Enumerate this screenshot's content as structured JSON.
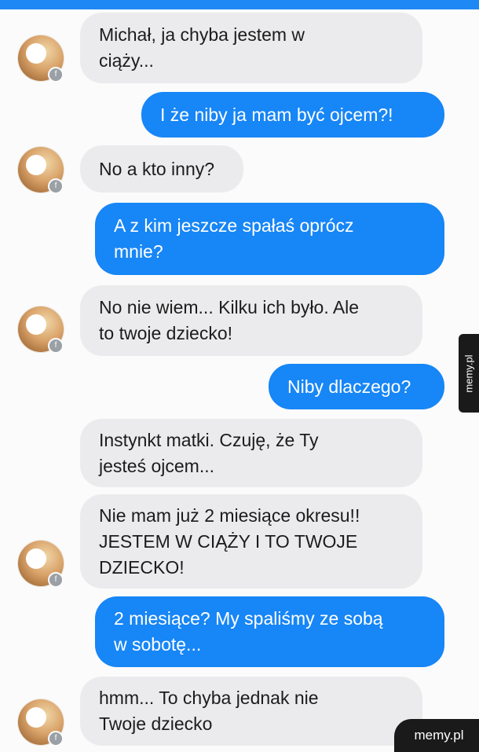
{
  "chat": {
    "messages": [
      {
        "text": "Michał, ja chyba jestem w\nciąży..."
      },
      {
        "text": "I że niby ja mam być ojcem?!"
      },
      {
        "text": "No a kto inny?"
      },
      {
        "text": "A z kim jeszcze spałaś oprócz\nmnie?"
      },
      {
        "text": "No nie wiem... Kilku ich było. Ale\nto twoje dziecko!"
      },
      {
        "text": "Niby dlaczego?"
      },
      {
        "text": "Instynkt matki. Czuję, że Ty\njesteś ojcem..."
      },
      {
        "text": "Nie mam już 2 miesiące okresu!!\nJESTEM W CIĄŻY I TO TWOJE\nDZIECKO!"
      },
      {
        "text": "2 miesiące? My spaliśmy ze sobą\nw sobotę..."
      },
      {
        "text": "hmm... To chyba jednak nie\nTwoje dziecko"
      }
    ]
  },
  "watermark": {
    "side": "memy.pl",
    "corner": "memy.pl"
  }
}
